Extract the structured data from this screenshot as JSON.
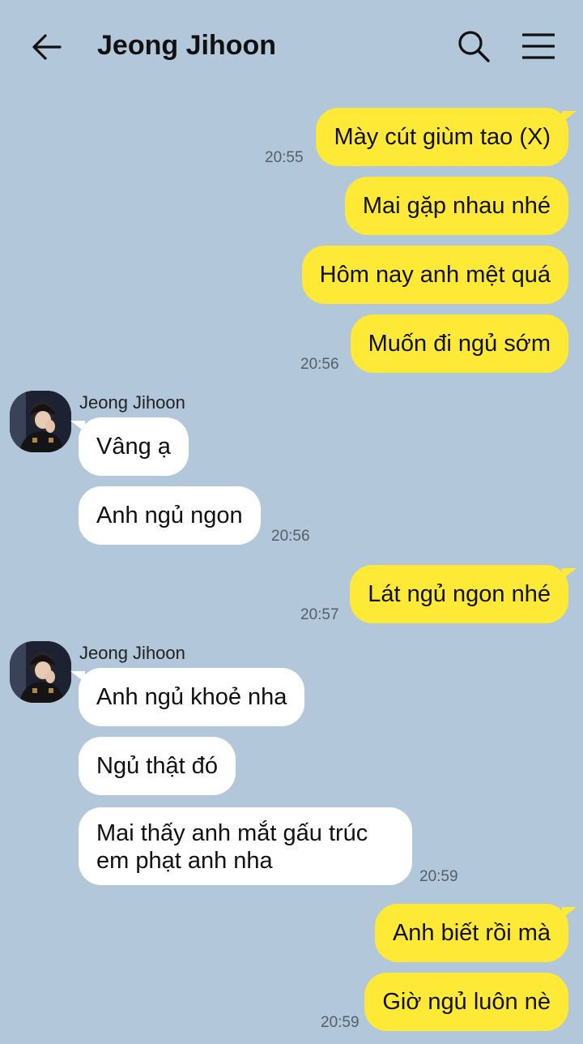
{
  "header": {
    "title": "Jeong Jihoon",
    "back_icon": "arrow-left-icon",
    "search_icon": "search-icon",
    "menu_icon": "hamburger-menu-icon"
  },
  "colors": {
    "background": "#b2c7da",
    "outgoing_bubble": "#fde936",
    "incoming_bubble": "#ffffff"
  },
  "messages": [
    {
      "dir": "out",
      "text": "Mày cút giùm tao (X)",
      "time": "20:55"
    },
    {
      "dir": "out",
      "text": "Mai gặp nhau nhé"
    },
    {
      "dir": "out",
      "text": "Hôm nay anh mệt quá"
    },
    {
      "dir": "out",
      "text": "Muốn đi ngủ sớm",
      "time": "20:56"
    },
    {
      "dir": "in",
      "sender": "Jeong Jihoon",
      "text": "Vâng ạ"
    },
    {
      "dir": "in",
      "text": "Anh ngủ ngon",
      "time": "20:56"
    },
    {
      "dir": "out",
      "text": "Lát ngủ ngon nhé",
      "time": "20:57"
    },
    {
      "dir": "in",
      "sender": "Jeong Jihoon",
      "text": "Anh ngủ khoẻ nha"
    },
    {
      "dir": "in",
      "text": "Ngủ thật đó"
    },
    {
      "dir": "in",
      "text": "Mai thấy anh mắt gấu trúc em phạt anh nha",
      "time": "20:59"
    },
    {
      "dir": "out",
      "text": "Anh biết rồi mà"
    },
    {
      "dir": "out",
      "text": "Giờ ngủ luôn nè",
      "time": "20:59"
    }
  ]
}
